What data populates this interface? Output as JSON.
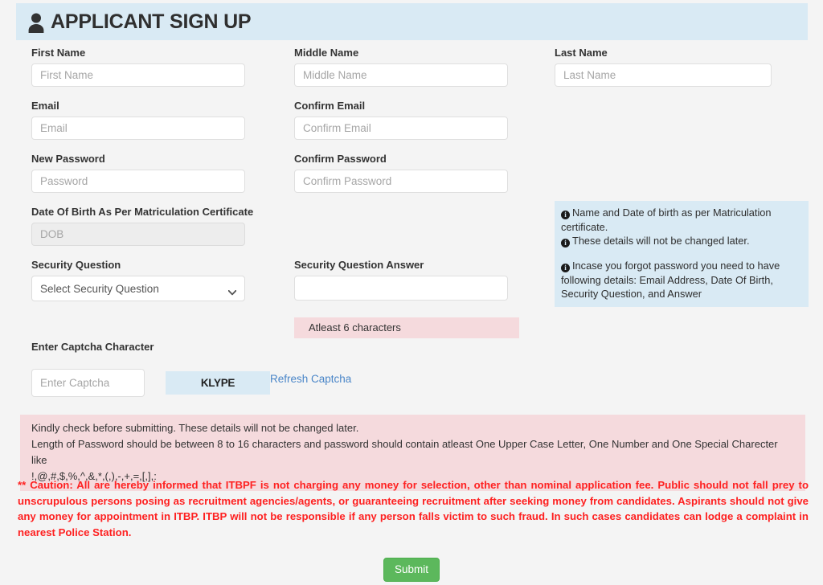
{
  "header": {
    "title": "APPLICANT SIGN UP",
    "icon": "person-icon"
  },
  "fields": {
    "first_name": {
      "label": "First Name",
      "placeholder": "First Name",
      "value": ""
    },
    "middle_name": {
      "label": "Middle Name",
      "placeholder": "Middle Name",
      "value": ""
    },
    "last_name": {
      "label": "Last Name",
      "placeholder": "Last Name",
      "value": ""
    },
    "email": {
      "label": "Email",
      "placeholder": "Email",
      "value": ""
    },
    "confirm_email": {
      "label": "Confirm Email",
      "placeholder": "Confirm Email",
      "value": ""
    },
    "new_password": {
      "label": "New Password",
      "placeholder": "Password",
      "value": ""
    },
    "confirm_password": {
      "label": "Confirm Password",
      "placeholder": "Confirm Password",
      "value": ""
    },
    "dob": {
      "label": "Date Of Birth As Per Matriculation Certificate",
      "placeholder": "DOB",
      "value": ""
    },
    "security_question": {
      "label": "Security Question",
      "selected": "Select Security Question"
    },
    "security_answer": {
      "label": "Security Question Answer",
      "placeholder": "",
      "value": "",
      "hint": "Atleast 6 characters"
    },
    "captcha": {
      "label": "Enter Captcha Character",
      "placeholder": "Enter Captcha",
      "value": "",
      "image_text": "KLYPE",
      "refresh_label": "Refresh Captcha"
    }
  },
  "info_boxes": [
    {
      "lines": [
        "Name and Date of birth as per Matriculation certificate.",
        "These details will not be changed later."
      ]
    },
    {
      "lines": [
        "Incase you forgot password you need to have following details: Email Address, Date Of Birth, Security Question, and Answer"
      ]
    }
  ],
  "notice": {
    "line1": "Kindly check before submitting. These details will not be changed later.",
    "line2": "Length of Password should be between 8 to 16 characters and password should contain atleast One Upper Case Letter, One Number and One Special Charecter like",
    "line3": "!,@,#,$,%,^,&,*,(,),-,+,=,[,],:"
  },
  "caution": {
    "text": "** Caution: All are hereby informed that ITBPF is not charging any money for selection, other than nominal application fee. Public should not fall prey to unscrupulous persons posing as recruitment agencies/agents, or guaranteeing recruitment after seeking money from candidates. Aspirants should not give any money for appointment in ITBP. ITBP will not be responsible if any person falls victim to such fraud. In such cases candidates can lodge a complaint in nearest Police Station."
  },
  "submit": {
    "label": "Submit"
  },
  "colors": {
    "header_bg": "#d9eaf4",
    "info_bg": "#d9eaf4",
    "pink_bg": "#f5dadd",
    "caution_text": "#fe2121",
    "submit_bg": "#5cb85c",
    "link": "#4a86c8",
    "page_bg": "#f4f4f4"
  }
}
